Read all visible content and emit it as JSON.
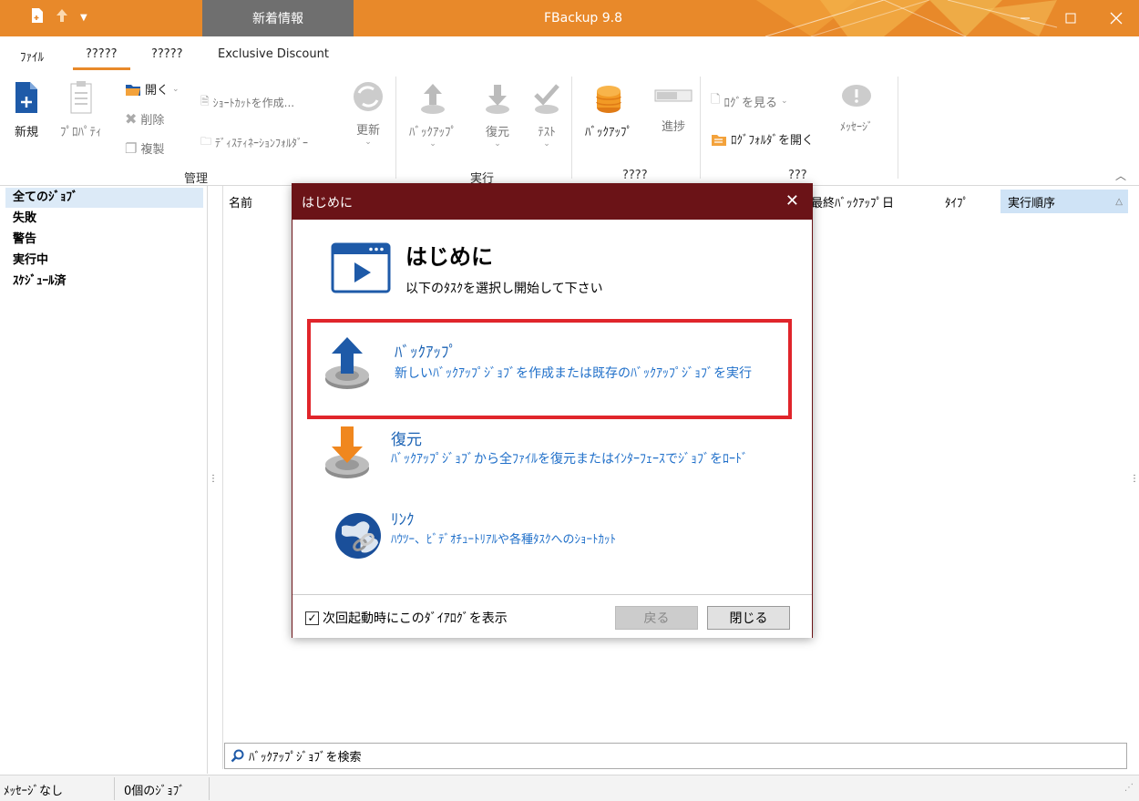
{
  "titlebar": {
    "whats_new_tab": "新着情報",
    "app_title": "FBackup 9.8",
    "colors": {
      "accent": "#e8892a",
      "tab_bg": "#6f6f6f"
    }
  },
  "menu": {
    "tabs": [
      {
        "label": "ﾌｧｲﾙ"
      },
      {
        "label": "?????"
      },
      {
        "label": "?????"
      },
      {
        "label": "Exclusive Discount"
      }
    ]
  },
  "ribbon": {
    "new": "新規",
    "properties": "ﾌﾟﾛﾊﾟﾃｨ",
    "open": "開く",
    "delete": "削除",
    "duplicate": "複製",
    "create_shortcut": "ｼｮｰﾄｶｯﾄを作成...",
    "destination_folder": "ﾃﾞｨｽﾃｨﾈｰｼｮﾝﾌｫﾙﾀﾞｰ",
    "update": "更新",
    "group_manage": "管理",
    "backup": "ﾊﾞｯｸｱｯﾌﾟ",
    "restore": "復元",
    "test": "ﾃｽﾄ",
    "group_run": "実行",
    "backup2": "ﾊﾞｯｸｱｯﾌﾟ",
    "progress": "進捗",
    "group_q4": "????",
    "view_log": "ﾛｸﾞを見る",
    "open_log_folder": "ﾛｸﾞﾌｫﾙﾀﾞを開く",
    "messages": "ﾒｯｾｰｼﾞ",
    "group_q3": "???"
  },
  "sidebar": {
    "items": [
      {
        "label": "全てのｼﾞｮﾌﾞ"
      },
      {
        "label": "失敗"
      },
      {
        "label": "警告"
      },
      {
        "label": "実行中"
      },
      {
        "label": "ｽｹｼﾞｭｰﾙ済"
      }
    ]
  },
  "list": {
    "columns": {
      "name": "名前",
      "last_backup": "最終ﾊﾞｯｸｱｯﾌﾟ日",
      "type": "ﾀｲﾌﾟ",
      "run_order": "実行順序"
    },
    "search_placeholder": "ﾊﾞｯｸｱｯﾌﾟｼﾞｮﾌﾞを検索"
  },
  "status": {
    "messages": "ﾒｯｾｰｼﾞなし",
    "jobs": "0個のｼﾞｮﾌﾞ"
  },
  "dialog": {
    "title": "はじめに",
    "heading": "はじめに",
    "subheading": "以下のﾀｽｸを選択し開始して下さい",
    "tasks": [
      {
        "title": "ﾊﾞｯｸｱｯﾌﾟ",
        "desc": "新しいﾊﾞｯｸｱｯﾌﾟｼﾞｮﾌﾞを作成または既存のﾊﾞｯｸｱｯﾌﾟｼﾞｮﾌﾞを実行"
      },
      {
        "title": "復元",
        "desc": "ﾊﾞｯｸｱｯﾌﾟｼﾞｮﾌﾞから全ﾌｧｲﾙを復元またはｲﾝﾀｰﾌｪｰｽでｼﾞｮﾌﾞをﾛｰﾄﾞ"
      },
      {
        "title": "ﾘﾝｸ",
        "desc": "ﾊｳﾂｰ、ﾋﾞﾃﾞｵﾁｭｰﾄﾘｱﾙや各種ﾀｽｸへのｼｮｰﾄｶｯﾄ"
      }
    ],
    "show_on_startup": "次回起動時にこのﾀﾞｲｱﾛｸﾞを表示",
    "show_on_startup_checked": true,
    "back_button": "戻る",
    "close_button": "閉じる",
    "colors": {
      "title_bg": "#6b1317",
      "highlight": "#e0252b",
      "link": "#1a62b4"
    }
  }
}
